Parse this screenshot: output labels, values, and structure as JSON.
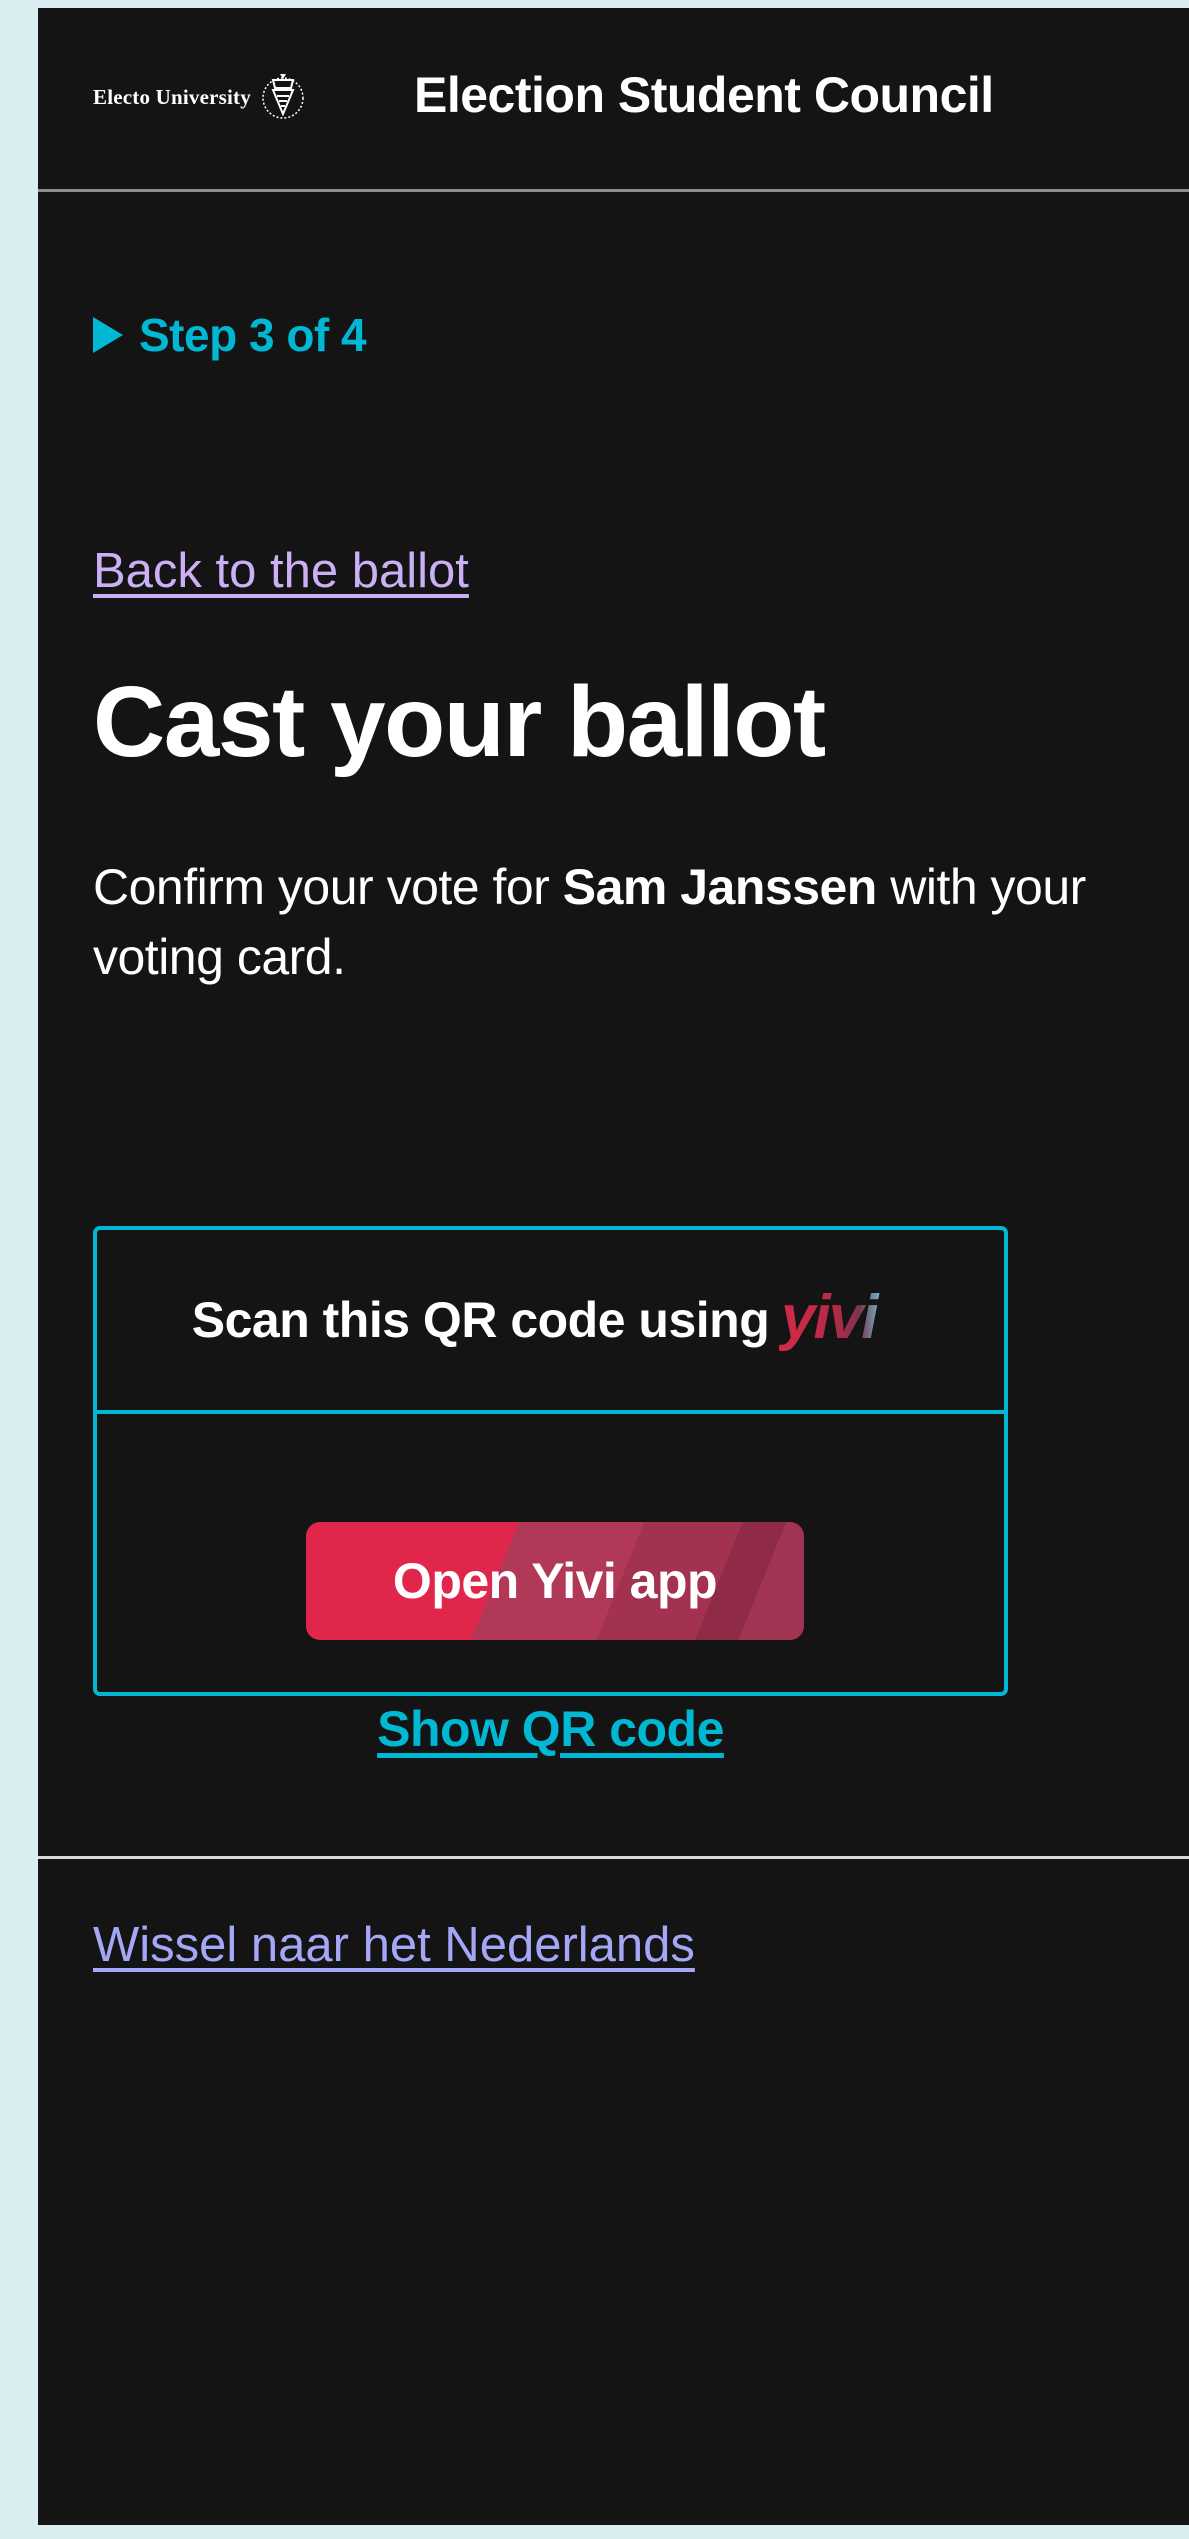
{
  "header": {
    "university_name": "Electo University",
    "site_title": "Election Student Council"
  },
  "progress": {
    "step_label": "Step 3 of 4",
    "current_step": 3,
    "total_steps": 4
  },
  "main": {
    "back_link": "Back to the ballot",
    "title": "Cast your ballot",
    "intro_before": "Confirm your vote for ",
    "candidate_name": "Sam Janssen",
    "intro_after": " with your voting card."
  },
  "yivi": {
    "scan_label": "Scan this QR code using",
    "logo_text": "yivi",
    "open_app_button": "Open Yivi app",
    "show_qr_link": "Show QR code"
  },
  "footer": {
    "language_link": "Wissel naar het Nederlands"
  },
  "colors": {
    "page_background": "#141414",
    "accent_cyan": "#00b8d4",
    "button_red": "#e0264a",
    "back_link": "#cbb0f5",
    "language_link": "#a3a7f5",
    "outer_background": "#daedf0"
  }
}
